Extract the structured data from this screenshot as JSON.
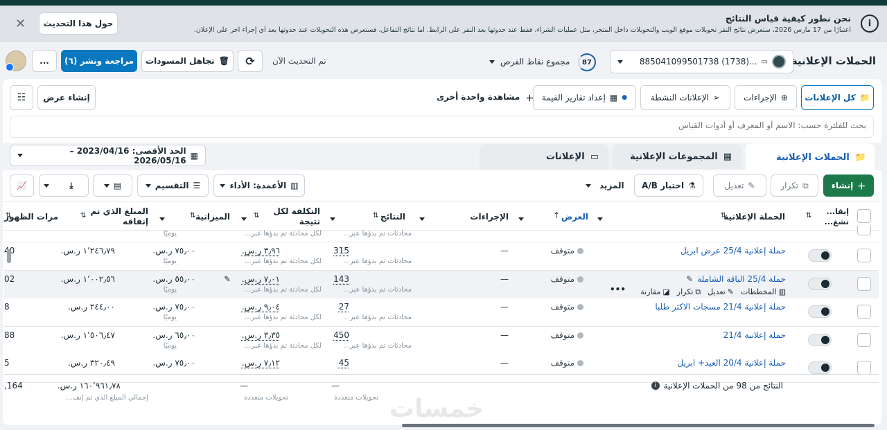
{
  "banner": {
    "title": "نحن نطور كيفية قياس النتائج",
    "body": "اعتبارًا من 17 مارس 2026، ستعرض نتائج النقر تحويلات موقع الويب والتحويلات داخل المتجر، مثل عمليات الشراء، فقط عند حدوثها بعد النقر على الرابط. أما نتائج التفاعل، فستعرض هذه التحويلات عند حدوثها بعد أي إجراء آخر على الإعلان.",
    "about_button": "حول هذا التحديث"
  },
  "header": {
    "page_title": "الحملات الإعلانية",
    "account_label": "885041099501738 (1738)...",
    "opportunity_score": "87",
    "opportunity_label": "مجموع نقاط الفرص",
    "updated_label": "تم التحديث الآن",
    "discard_drafts": "تجاهل المسودات",
    "review_publish": "مراجعة ونشر (٦)",
    "more": "..."
  },
  "view_bar": {
    "all_ads": "كل الإعلانات",
    "actions": "الإجراءات",
    "active_ads": "الإعلانات النشطة",
    "value_reports": "إعداد تقارير القيمة",
    "more_views": "مشاهدة واحدة أخرى",
    "create_view": "إنشاء عرض"
  },
  "search": {
    "placeholder": "بحث للفلترة حسب: الاسم أو المعرف أو أدوات القياس"
  },
  "tabs": {
    "campaigns": "الحملات الإعلانية",
    "adsets": "المجموعات الإعلانية",
    "ads": "الإعلانات",
    "date_range": "الحد الأقصى: 2023/04/16 – 2026/05/16"
  },
  "toolbar": {
    "create": "إنشاء",
    "duplicate": "تكرار",
    "edit": "تعديل",
    "ab_test": "اختبار A/B",
    "more": "المزيد",
    "columns": "الأعمدة: الأداء",
    "breakdown": "التقسيم"
  },
  "columns": {
    "delivery": "إيقا... تشغ...",
    "campaign": "الحملة الإعلانية",
    "offer": "العرض",
    "actions": "الإجراءات",
    "results": "النتائج",
    "cost_per_result": "التكلفة لكل نتيجة",
    "budget": "الميزانية",
    "amount_spent": "المبلغ الذي تم إنفاقه",
    "impressions": "مرات الظهور"
  },
  "partial_row": {
    "results_sub": "محادثات تم بدؤها عبر...",
    "cost_sub": "لكل محادثة تم بدؤها عبر...",
    "budget_sub": "يوميًا"
  },
  "rows": [
    {
      "name": "حملة إعلانية 25/4 عرض ابريل",
      "status": "متوقف",
      "actions": "—",
      "results": "315",
      "results_sub": "محادثات تم بدؤها عبر...",
      "cost": "٣٫٩٦ ر.س.",
      "cost_sub": "لكل محادثة تم بدؤها عبر...",
      "budget": "٧٥٫٠٠ ر.س.",
      "budget_sub": "يوميًا",
      "spent": "١٬٢٤٦٫٧٩ ر.س.",
      "impressions": "40"
    },
    {
      "name": "حملة 25/4 الباقة الشاملة",
      "status": "متوقف",
      "actions": "—",
      "results": "143",
      "results_sub": "محادثات تم بدؤها عبر...",
      "cost": "٧٫٠١ ر.س.",
      "cost_sub": "لكل محادثة تم بدؤها عبر...",
      "budget": "٥٥٫٠٠ ر.س.",
      "budget_sub": "يوميًا",
      "spent": "١٬٠٠٢٫٥٦ ر.س.",
      "impressions": "02",
      "hover_actions": [
        "المخططات",
        "تعديل",
        "تكرار",
        "مقارنة"
      ]
    },
    {
      "name": "حملة إعلانية 21/4 مسجات الاكثر طلبا",
      "status": "متوقف",
      "actions": "—",
      "results": "27",
      "results_sub": "محادثات تم بدؤها عبر...",
      "cost": "٩٫٠٤ ر.س.",
      "cost_sub": "لكل محادثة تم بدؤها عبر...",
      "budget": "٧٥٫٠٠ ر.س.",
      "budget_sub": "يوميًا",
      "spent": "٢٤٤٫٠٠ ر.س.",
      "impressions": "8"
    },
    {
      "name": "حملة إعلانية 21/4",
      "status": "متوقف",
      "actions": "—",
      "results": "450",
      "results_sub": "محادثات تم بدؤها عبر...",
      "cost": "٣٫٣٥ ر.س.",
      "cost_sub": "لكل محادثة تم بدؤها عبر...",
      "budget": "٦٥٫٠٠ ر.س.",
      "budget_sub": "يوميًا",
      "spent": "١٬٥٠٦٫٤٧ ر.س.",
      "impressions": "88"
    },
    {
      "name": "حملة إعلانية 20/4 العيد+ ابريل",
      "status": "متوقف",
      "actions": "—",
      "results": "45",
      "results_sub": "",
      "cost": "٧٫١٢ ر.س.",
      "cost_sub": "",
      "budget": "٧٥٫٠٠ ر.س.",
      "budget_sub": "",
      "spent": "٣٢٠٫٤٩ ر.س.",
      "impressions": "5"
    }
  ],
  "footer": {
    "summary": "النتائج من 98 من الحملات الإعلانية",
    "results": "—",
    "results_sub": "تحويلات متعددة",
    "cost": "—",
    "cost_sub": "تحويلات متعددة",
    "spent": "١٦٠٬٩٦١٫٧٨ ر.س.",
    "spent_sub": "إجمالي المبلغ الذي تم إنف...",
    "impressions": ",164"
  },
  "watermark": "خمسات"
}
